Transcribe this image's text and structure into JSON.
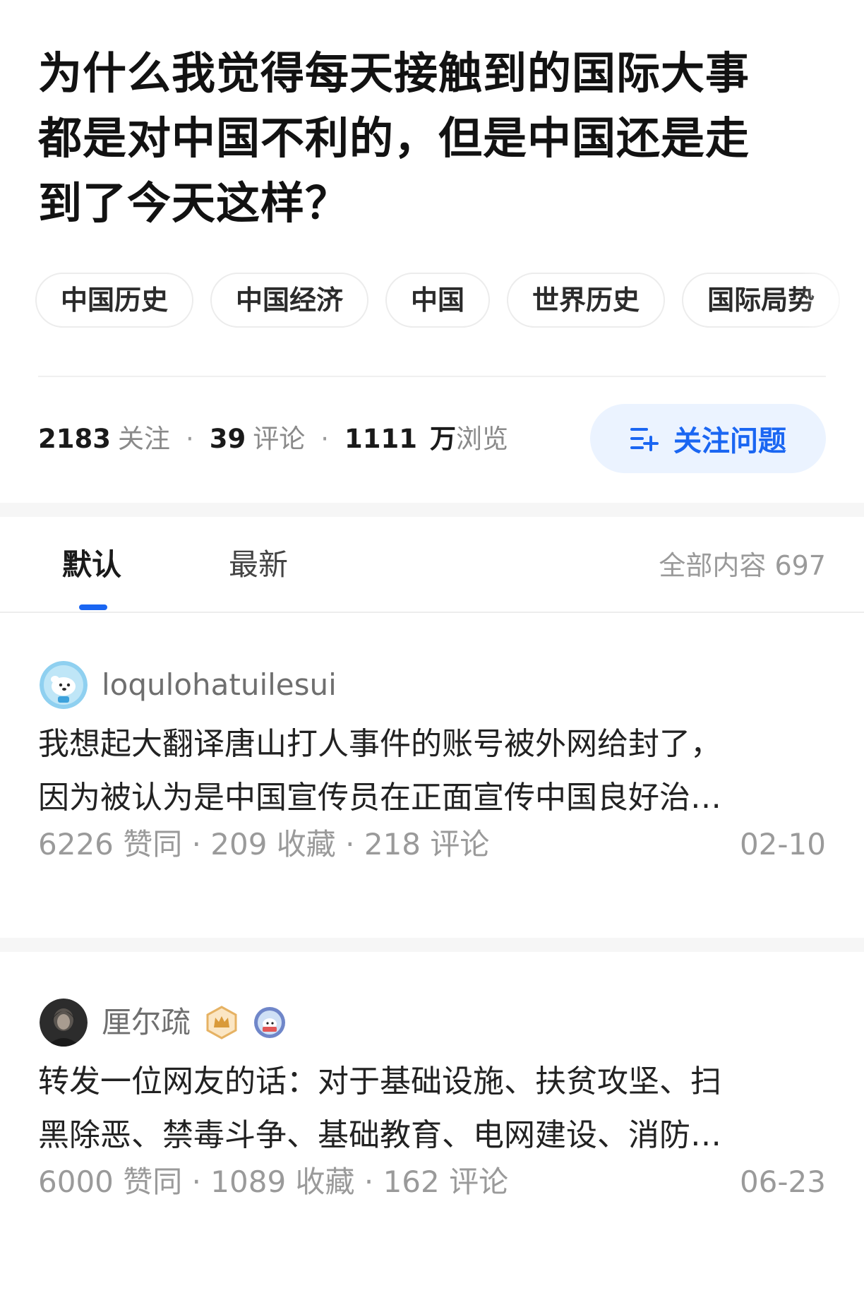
{
  "question": {
    "title_lines": [
      "为什么我觉得每天接触到的国际大事",
      "都是对中国不利的，但是中国还是走",
      "到了今天这样？"
    ],
    "topics": [
      "中国历史",
      "中国经济",
      "中国",
      "世界历史",
      "国际局势"
    ],
    "stats": {
      "followers": "2183",
      "followers_label": "关注",
      "comments": "39",
      "comments_label": "评论",
      "views": "1111",
      "views_unit": "万",
      "views_label": "浏览",
      "separator": "·"
    },
    "follow_button_label": "关注问题"
  },
  "tabs": {
    "default_label": "默认",
    "latest_label": "最新",
    "total_label": "全部内容 697"
  },
  "answers": [
    {
      "author": "loqulohatuilesui",
      "excerpt_lines": [
        "我想起大翻译唐山打人事件的账号被外网给封了，",
        "因为被认为是中国宣传员在正面宣传中国良好治…"
      ],
      "meta": "6226 赞同 · 209 收藏 · 218 评论",
      "date": "02-10"
    },
    {
      "author": "厘尔疏",
      "excerpt_lines": [
        "转发一位网友的话：对于基础设施、扶贫攻坚、扫",
        "黑除恶、禁毒斗争、基础教育、电网建设、消防…"
      ],
      "meta": "6000 赞同 · 1089 收藏 · 162 评论",
      "date": "06-23"
    }
  ],
  "colors": {
    "accent": "#1a66f2",
    "follow_bg": "#ebf3ff",
    "muted_text": "#9a9a9a",
    "separator_band": "#f6f6f6"
  }
}
